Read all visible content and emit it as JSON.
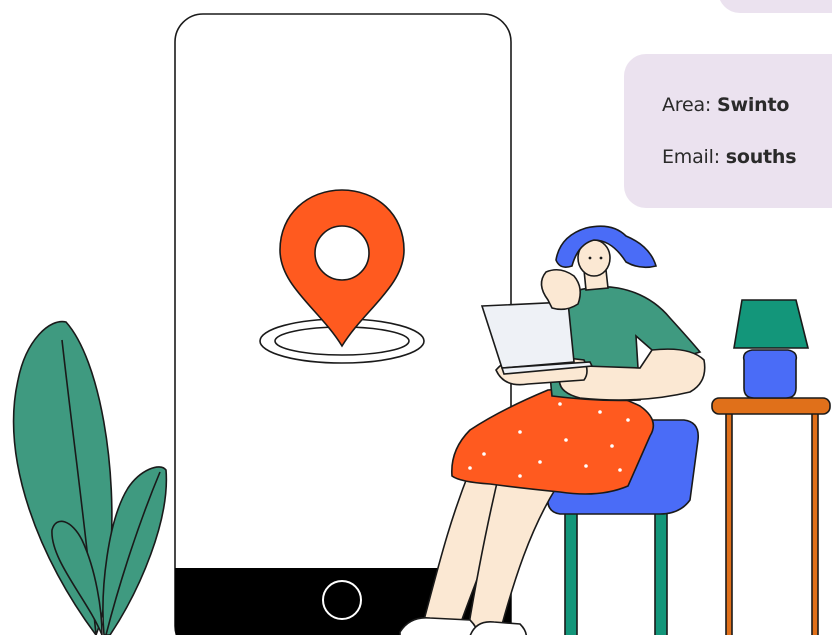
{
  "contact_card": {
    "area_label": "Area:",
    "area_value": "Swinto",
    "email_label": "Email:",
    "email_value": "souths"
  },
  "colors": {
    "card_bg": "#ebe2ef",
    "pin": "#ff5a1f",
    "plant": "#3f9a80",
    "chair": "#4a6cf7",
    "skirt": "#ff5a1f",
    "hair": "#4a6cf7",
    "lamp_shade": "#13967a",
    "table": "#e0701a"
  },
  "icons": [
    "map-pin-icon",
    "home-button-icon"
  ]
}
